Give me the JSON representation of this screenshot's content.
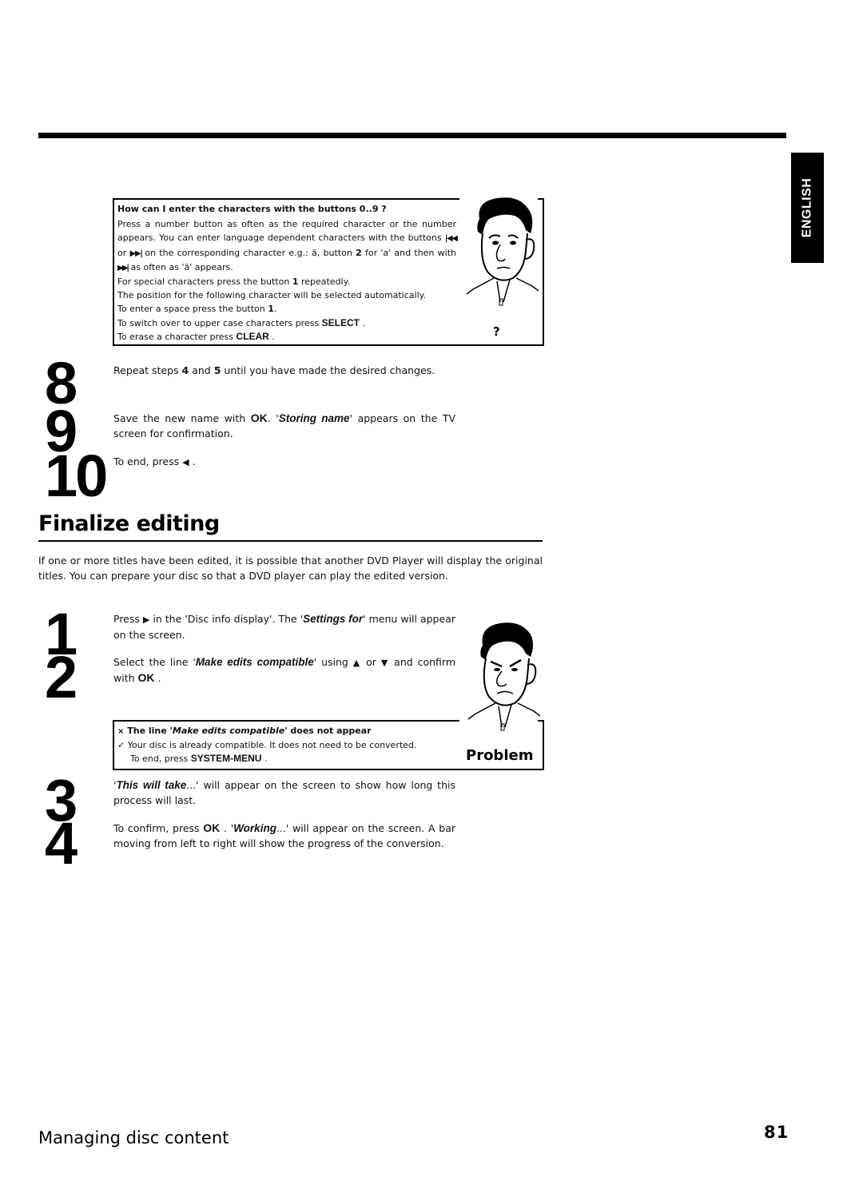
{
  "language_tab": "ENGLISH",
  "tip": {
    "question": "How can I enter the characters with the buttons  0..9 ?",
    "p1_a": "Press a number button as often as the required character or the number appears. You can enter language dependent characters with the buttons",
    "prev_icon": "skip-back-icon",
    "or": "or",
    "next_icon": "skip-forward-icon",
    "p1_b": "on the corresponding character e.g.: ä, button",
    "p1_key": "2",
    "p1_c": "for 'a' and then with",
    "p1_d": "as often as 'ä' appears.",
    "line_special_a": "For special characters press the button",
    "line_special_key": "1",
    "line_special_b": "repeatedly.",
    "line_position": "The position for the following character will be selected automatically.",
    "line_space_a": "To enter a space press the button",
    "line_space_key": "1",
    "line_space_b": ".",
    "line_upper_a": "To switch over to upper case characters press",
    "line_upper_key": "SELECT",
    "line_upper_b": ".",
    "line_erase_a": "To erase a character press",
    "line_erase_key": "CLEAR",
    "line_erase_b": ".",
    "qmark": "?"
  },
  "steps_top": [
    {
      "num": "8",
      "text_a": "Repeat steps",
      "k1": "4",
      "text_b": "and",
      "k2": "5",
      "text_c": "until you have made the desired changes."
    },
    {
      "num": "9",
      "text_a": "Save the new name with",
      "key": "OK",
      "text_b": ". '",
      "italic": "Storing name",
      "text_c": "' appears on the TV screen for confirmation."
    },
    {
      "num": "10",
      "text_a": "To end, press",
      "icon": "left-arrow-icon",
      "glyph": "◀",
      "text_b": "."
    }
  ],
  "section": {
    "title": "Finalize editing",
    "intro": "If one or more titles have been edited, it is possible that another DVD Player will display the original titles. You can prepare your disc so that a DVD player can play the edited version."
  },
  "steps_mid": [
    {
      "num": "1",
      "text_a": "Press",
      "glyph": "▶",
      "text_b": "in the 'Disc info display'. The '",
      "italic": "Settings for",
      "text_c": "' menu will appear on the screen."
    },
    {
      "num": "2",
      "text_a": "Select the line '",
      "italic": "Make edits compatible",
      "text_b": "' using",
      "up": "▲",
      "or": "or",
      "down": "▼",
      "text_c": "and confirm with",
      "key": "OK",
      "text_d": "."
    }
  ],
  "problem": {
    "cross": "×",
    "head_a": "The line '",
    "head_italic": "Make edits compatible",
    "head_b": "' does not appear",
    "check": "✓",
    "line1": "Your disc is already compatible. It does not need to be converted.",
    "line2_a": "To end, press",
    "line2_key": "SYSTEM-MENU",
    "line2_b": ".",
    "label": "Problem"
  },
  "steps_bottom": [
    {
      "num": "3",
      "text_a": "'",
      "italic": "This will take",
      "text_b": "...' will appear on the screen to show how long this process will last."
    },
    {
      "num": "4",
      "text_a": "To confirm, press",
      "key": "OK",
      "text_b": ". '",
      "italic": "Working",
      "text_c": "...' will appear on the screen. A bar moving from left to right will show the progress of the conversion."
    }
  ],
  "footer": {
    "chapter": "Managing disc content",
    "page": "81"
  }
}
